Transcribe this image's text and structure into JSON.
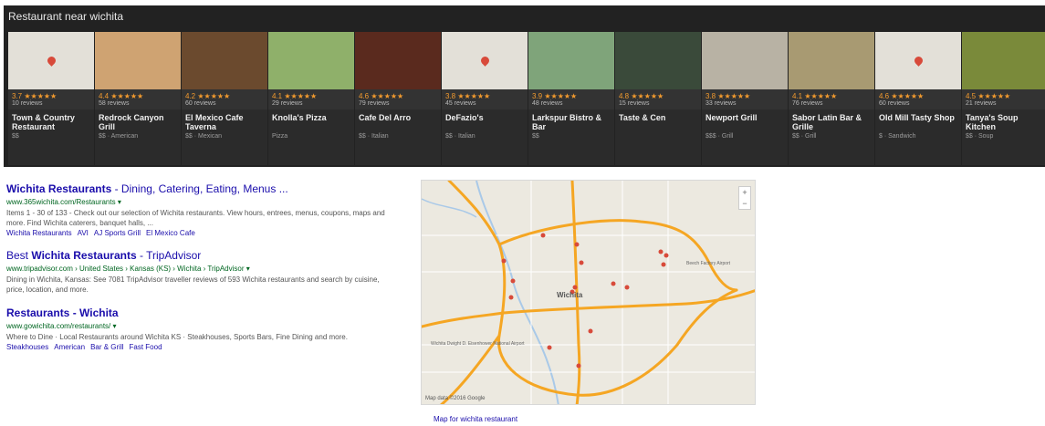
{
  "carousel": {
    "title": "Restaurant near wichita",
    "cards": [
      {
        "name": "Town & Country Restaurant",
        "rating": "3.7",
        "reviews": "10 reviews",
        "sub": "$$",
        "thumb_color": "#e3e0d8",
        "map_pin": true
      },
      {
        "name": "Redrock Canyon Grill",
        "rating": "4.4",
        "reviews": "58 reviews",
        "sub": "$$ · American",
        "thumb_color": "#cfa372",
        "map_pin": false
      },
      {
        "name": "El Mexico Cafe Taverna",
        "rating": "4.2",
        "reviews": "60 reviews",
        "sub": "$$ · Mexican",
        "thumb_color": "#6b4a2e",
        "map_pin": false
      },
      {
        "name": "Knolla's Pizza",
        "rating": "4.1",
        "reviews": "29 reviews",
        "sub": "Pizza",
        "thumb_color": "#8fb06a",
        "map_pin": false
      },
      {
        "name": "Cafe Del Arro",
        "rating": "4.6",
        "reviews": "79 reviews",
        "sub": "$$ · Italian",
        "thumb_color": "#5a2a1e",
        "map_pin": false
      },
      {
        "name": "DeFazio's",
        "rating": "3.8",
        "reviews": "45 reviews",
        "sub": "$$ · Italian",
        "thumb_color": "#e3e0d8",
        "map_pin": true
      },
      {
        "name": "Larkspur Bistro & Bar",
        "rating": "3.9",
        "reviews": "48 reviews",
        "sub": "$$",
        "thumb_color": "#7fa47a",
        "map_pin": false
      },
      {
        "name": "Taste & Cen",
        "rating": "4.8",
        "reviews": "15 reviews",
        "sub": "",
        "thumb_color": "#3a4a3a",
        "map_pin": false
      },
      {
        "name": "Newport Grill",
        "rating": "3.8",
        "reviews": "33 reviews",
        "sub": "$$$ · Grill",
        "thumb_color": "#b8b2a4",
        "map_pin": false
      },
      {
        "name": "Sabor Latin Bar & Grille",
        "rating": "4.1",
        "reviews": "76 reviews",
        "sub": "$$ · Grill",
        "thumb_color": "#a89a72",
        "map_pin": false
      },
      {
        "name": "Old Mill Tasty Shop",
        "rating": "4.6",
        "reviews": "60 reviews",
        "sub": "$ · Sandwich",
        "thumb_color": "#e3e0d8",
        "map_pin": true
      },
      {
        "name": "Tanya's Soup Kitchen",
        "rating": "4.5",
        "reviews": "21 reviews",
        "sub": "$$ · Soup",
        "thumb_color": "#7a8a3a",
        "map_pin": false
      }
    ]
  },
  "results": [
    {
      "title_bold": "Wichita Restaurants",
      "title_rest": " - Dining, Catering, Eating, Menus ...",
      "url": "www.365wichita.com/Restaurants",
      "snippet": "Items 1 - 30 of 133 - Check out our selection of Wichita restaurants. View hours, entrees, menus, coupons, maps and more. Find Wichita caterers, banquet halls, ...",
      "links": [
        "Wichita Restaurants",
        "AVI",
        "AJ Sports Grill",
        "El Mexico Cafe"
      ]
    },
    {
      "title_pre": "Best ",
      "title_bold": "Wichita Restaurants",
      "title_rest": " - TripAdvisor",
      "url": "www.tripadvisor.com › United States › Kansas (KS) › Wichita › TripAdvisor",
      "snippet": "Dining in Wichita, Kansas: See 7081 TripAdvisor traveller reviews of 593 Wichita restaurants and search by cuisine, price, location, and more.",
      "links": []
    },
    {
      "title_bold": "Restaurants - Wichita",
      "title_rest": "",
      "url": "www.gowichita.com/restaurants/",
      "snippet": "Where to Dine · Local Restaurants around Wichita KS · Steakhouses, Sports Bars, Fine Dining and more.",
      "links": [
        "Steakhouses",
        "American",
        "Bar & Grill",
        "Fast Food"
      ]
    }
  ],
  "map": {
    "zoom_in": "+",
    "zoom_out": "−",
    "caption": "Map data ©2016 Google",
    "link_text": "Map for wichita restaurant",
    "labels": {
      "city": "Wichita",
      "airport_east": "Beech Factory Airport",
      "airport_west": "Wichita Dwight D. Eisenhower National Airport"
    },
    "colors": {
      "highway": "#f5a623",
      "pin": "#d84a3a",
      "water": "#a9c9e8",
      "land": "#ece9e0"
    }
  }
}
